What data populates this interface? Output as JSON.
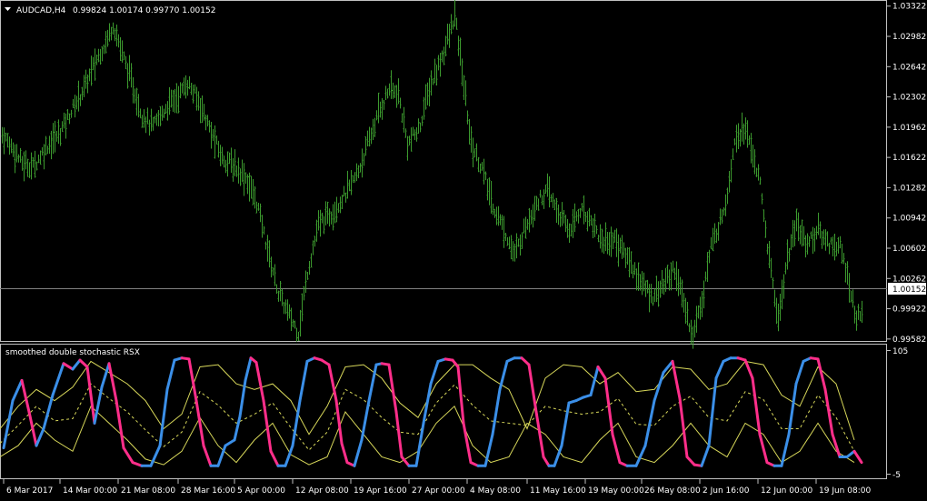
{
  "header": {
    "symbol_timeframe": "AUDCAD,H4",
    "ohlc": "0.99824 1.00174 0.99770 1.00152"
  },
  "indicator": {
    "name": "smoothed double stochastic RSX"
  },
  "colors": {
    "background": "#000000",
    "bars": "#3c9a2e",
    "rsx_up": "#3b8fe8",
    "rsx_down": "#ff2e8a",
    "envelope": "#d8d85a",
    "current_price_line": "#808080"
  },
  "chart_data": [
    {
      "type": "ohlc",
      "title": "AUDCAD,H4",
      "y_ticks": [
        "1.03322",
        "1.02982",
        "1.02642",
        "1.02302",
        "1.01962",
        "1.01622",
        "1.01282",
        "1.00942",
        "1.00602",
        "1.00262",
        "0.99922",
        "0.99582"
      ],
      "ylim": [
        0.9956,
        1.0336
      ],
      "current_price": "1.00152",
      "anchors": [
        [
          0,
          1.019
        ],
        [
          10,
          1.0178
        ],
        [
          24,
          1.0156
        ],
        [
          36,
          1.0152
        ],
        [
          52,
          1.0176
        ],
        [
          64,
          1.0188
        ],
        [
          78,
          1.0214
        ],
        [
          92,
          1.024
        ],
        [
          106,
          1.0272
        ],
        [
          118,
          1.0296
        ],
        [
          124,
          1.0312
        ],
        [
          132,
          1.0286
        ],
        [
          144,
          1.0248
        ],
        [
          156,
          1.021
        ],
        [
          168,
          1.0196
        ],
        [
          182,
          1.0218
        ],
        [
          196,
          1.0232
        ],
        [
          206,
          1.0246
        ],
        [
          220,
          1.0222
        ],
        [
          232,
          1.019
        ],
        [
          244,
          1.0162
        ],
        [
          258,
          1.0152
        ],
        [
          270,
          1.014
        ],
        [
          282,
          1.0112
        ],
        [
          294,
          1.006
        ],
        [
          306,
          1.001
        ],
        [
          318,
          0.9984
        ],
        [
          328,
          0.9966
        ],
        [
          338,
          1.0034
        ],
        [
          350,
          1.0086
        ],
        [
          364,
          1.01
        ],
        [
          378,
          1.0118
        ],
        [
          392,
          1.0142
        ],
        [
          404,
          1.0176
        ],
        [
          416,
          1.0212
        ],
        [
          428,
          1.024
        ],
        [
          438,
          1.0232
        ],
        [
          448,
          1.0178
        ],
        [
          460,
          1.0192
        ],
        [
          472,
          1.024
        ],
        [
          484,
          1.027
        ],
        [
          494,
          1.03
        ],
        [
          500,
          1.0322
        ],
        [
          508,
          1.026
        ],
        [
          518,
          1.0178
        ],
        [
          530,
          1.015
        ],
        [
          542,
          1.0108
        ],
        [
          554,
          1.0082
        ],
        [
          566,
          1.0052
        ],
        [
          578,
          1.0086
        ],
        [
          590,
          1.0112
        ],
        [
          602,
          1.0124
        ],
        [
          614,
          1.01
        ],
        [
          626,
          1.008
        ],
        [
          638,
          1.0104
        ],
        [
          650,
          1.0092
        ],
        [
          662,
          1.0068
        ],
        [
          676,
          1.007
        ],
        [
          690,
          1.005
        ],
        [
          704,
          1.0024
        ],
        [
          716,
          1.0006
        ],
        [
          730,
          1.002
        ],
        [
          742,
          1.0038
        ],
        [
          752,
          0.9998
        ],
        [
          762,
          0.9962
        ],
        [
          772,
          1.0004
        ],
        [
          782,
          1.0062
        ],
        [
          792,
          1.009
        ],
        [
          800,
          1.0122
        ],
        [
          808,
          1.0184
        ],
        [
          818,
          1.0196
        ],
        [
          828,
          1.0168
        ],
        [
          836,
          1.013
        ],
        [
          846,
          1.0048
        ],
        [
          856,
          0.998
        ],
        [
          866,
          1.005
        ],
        [
          876,
          1.0086
        ],
        [
          888,
          1.0066
        ],
        [
          900,
          1.008
        ],
        [
          912,
          1.0066
        ],
        [
          924,
          1.0062
        ],
        [
          934,
          1.002
        ],
        [
          942,
          0.998
        ],
        [
          948,
          0.999
        ]
      ]
    },
    {
      "type": "line",
      "title": "smoothed double stochastic RSX",
      "y_ticks": [
        "105",
        "-5"
      ],
      "ylim": [
        -5,
        105
      ],
      "series": [
        {
          "role": "rsx_main",
          "x": [
            4,
            14,
            24,
            32,
            40,
            48,
            58,
            70,
            80,
            88,
            96,
            104,
            112,
            120,
            128,
            136,
            146,
            156,
            166,
            176,
            184,
            192,
            200,
            208,
            216,
            224,
            232,
            240,
            248,
            258,
            264,
            270,
            276,
            282,
            290,
            298,
            306,
            314,
            322,
            330,
            338,
            346,
            354,
            362,
            370,
            376,
            382,
            390,
            398,
            406,
            414,
            420,
            428,
            436,
            442,
            450,
            458,
            466,
            474,
            482,
            490,
            498,
            504,
            510,
            518,
            526,
            534,
            542,
            550,
            558,
            566,
            574,
            582,
            590,
            598,
            604,
            610,
            618,
            626,
            634,
            642,
            650,
            658,
            666,
            674,
            682,
            690,
            700,
            710,
            720,
            730,
            740,
            748,
            756,
            764,
            772,
            780,
            788,
            796,
            804,
            812,
            820,
            828,
            836,
            844,
            852,
            860,
            868,
            876,
            884,
            892,
            900,
            908,
            916,
            924,
            932,
            940,
            948
          ],
          "y": [
            18,
            60,
            78,
            50,
            20,
            35,
            65,
            93,
            88,
            96,
            90,
            40,
            72,
            93,
            60,
            18,
            5,
            2,
            2,
            20,
            70,
            96,
            98,
            97,
            60,
            20,
            2,
            2,
            20,
            25,
            46,
            78,
            98,
            94,
            60,
            15,
            2,
            2,
            20,
            60,
            95,
            98,
            96,
            92,
            60,
            22,
            5,
            2,
            25,
            60,
            92,
            93,
            92,
            50,
            10,
            2,
            2,
            40,
            75,
            95,
            97,
            96,
            90,
            40,
            5,
            2,
            2,
            30,
            70,
            95,
            98,
            98,
            92,
            50,
            10,
            2,
            2,
            20,
            58,
            60,
            63,
            65,
            90,
            80,
            30,
            5,
            2,
            2,
            20,
            60,
            85,
            95,
            62,
            10,
            3,
            2,
            20,
            80,
            95,
            98,
            98,
            96,
            80,
            30,
            5,
            2,
            2,
            30,
            75,
            95,
            98,
            97,
            70,
            30,
            10,
            10,
            15,
            5
          ],
          "rising_color": "blue",
          "falling_color": "magenta"
        },
        {
          "role": "envelope_upper",
          "x": [
            0,
            20,
            40,
            60,
            80,
            100,
            120,
            140,
            160,
            180,
            200,
            220,
            240,
            260,
            280,
            300,
            320,
            340,
            360,
            380,
            400,
            420,
            440,
            460,
            480,
            500,
            520,
            540,
            560,
            580,
            600,
            620,
            640,
            660,
            680,
            700,
            720,
            740,
            760,
            780,
            800,
            820,
            840,
            860,
            880,
            900,
            920,
            940
          ],
          "y": [
            35,
            55,
            70,
            60,
            72,
            95,
            85,
            75,
            60,
            35,
            48,
            90,
            92,
            75,
            70,
            75,
            60,
            30,
            55,
            90,
            92,
            80,
            58,
            45,
            75,
            92,
            92,
            80,
            70,
            35,
            80,
            92,
            90,
            75,
            85,
            68,
            70,
            90,
            88,
            70,
            75,
            95,
            92,
            65,
            55,
            90,
            75,
            25
          ]
        },
        {
          "role": "envelope_lower",
          "x": [
            0,
            20,
            40,
            60,
            80,
            100,
            120,
            140,
            160,
            180,
            200,
            220,
            240,
            260,
            280,
            300,
            320,
            340,
            360,
            380,
            400,
            420,
            440,
            460,
            480,
            500,
            520,
            540,
            560,
            580,
            600,
            620,
            640,
            660,
            680,
            700,
            720,
            740,
            760,
            780,
            800,
            820,
            840,
            860,
            880,
            900,
            920,
            940
          ],
          "y": [
            10,
            20,
            40,
            25,
            15,
            55,
            40,
            25,
            8,
            3,
            15,
            45,
            20,
            5,
            25,
            40,
            12,
            3,
            10,
            50,
            30,
            10,
            5,
            15,
            40,
            55,
            20,
            5,
            10,
            40,
            30,
            10,
            5,
            25,
            40,
            10,
            5,
            20,
            40,
            20,
            10,
            40,
            30,
            5,
            15,
            40,
            15,
            5
          ]
        },
        {
          "role": "signal_dashed",
          "x": [
            0,
            20,
            40,
            60,
            80,
            100,
            120,
            140,
            160,
            180,
            200,
            220,
            240,
            260,
            280,
            300,
            320,
            340,
            360,
            380,
            400,
            420,
            440,
            460,
            480,
            500,
            520,
            540,
            560,
            580,
            600,
            620,
            640,
            660,
            680,
            700,
            720,
            740,
            760,
            780,
            800,
            820,
            840,
            860,
            880,
            900,
            920,
            940
          ],
          "y": [
            22,
            38,
            55,
            42,
            44,
            75,
            62,
            50,
            34,
            19,
            32,
            68,
            56,
            40,
            48,
            58,
            36,
            16,
            32,
            70,
            61,
            45,
            32,
            30,
            58,
            74,
            56,
            42,
            40,
            38,
            55,
            51,
            48,
            50,
            62,
            39,
            38,
            55,
            64,
            45,
            42,
            68,
            61,
            35,
            35,
            65,
            45,
            15
          ]
        }
      ]
    }
  ],
  "x_axis": {
    "labels": [
      "6 Mar 2017",
      "14 Mar 00:00",
      "21 Mar 08:00",
      "28 Mar 16:00",
      "5 Apr 00:00",
      "12 Apr 08:00",
      "19 Apr 16:00",
      "27 Apr 00:00",
      "4 May 08:00",
      "11 May 16:00",
      "19 May 00:00",
      "26 May 08:00",
      "2 Jun 16:00",
      "12 Jun 00:00",
      "19 Jun 08:00"
    ]
  }
}
